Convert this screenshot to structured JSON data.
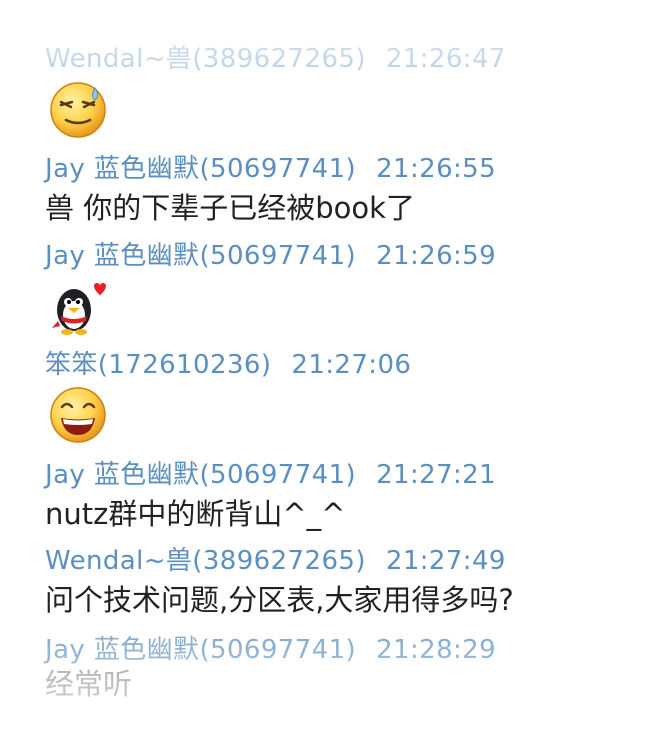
{
  "colors": {
    "header_text": "#5b8fc0",
    "message_text": "#222222",
    "background": "#ffffff"
  },
  "messages": [
    {
      "sender": "Wendal~兽(389627265)",
      "time": "21:26:47",
      "emoticon": "sweat-smile-emoji-icon"
    },
    {
      "sender": "Jay 蓝色幽默(50697741)",
      "time": "21:26:55",
      "text": "兽 你的下辈子已经被book了"
    },
    {
      "sender": "Jay 蓝色幽默(50697741)",
      "time": "21:26:59",
      "emoticon": "penguin-heart-emoji-icon"
    },
    {
      "sender": "笨笨(172610236)",
      "time": "21:27:06",
      "emoticon": "grin-emoji-icon"
    },
    {
      "sender": "Jay 蓝色幽默(50697741)",
      "time": "21:27:21",
      "text": "nutz群中的断背山^_^"
    },
    {
      "sender": "Wendal~兽(389627265)",
      "time": "21:27:49",
      "text": "问个技术问题,分区表,大家用得多吗?"
    },
    {
      "sender": "Jay 蓝色幽默(50697741)",
      "time": "21:28:29",
      "text": "经常听"
    }
  ]
}
